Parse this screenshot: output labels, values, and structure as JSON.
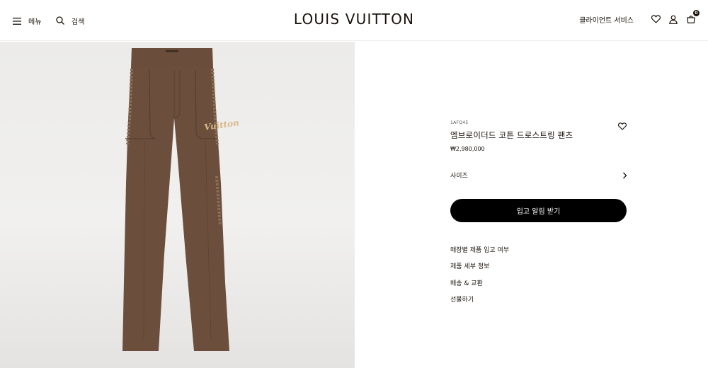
{
  "header": {
    "menu_label": "메뉴",
    "search_label": "검색",
    "logo": "LOUIS VUITTON",
    "client_service": "클라이언트 서비스",
    "bag_count": "0"
  },
  "product": {
    "sku": "1AFQ45",
    "name": "엠브로이더드 코튼 드로스트링 팬츠",
    "price": "₩2,980,000",
    "image_embroidery": "Vuitton"
  },
  "options": {
    "size_label": "사이즈"
  },
  "cta": {
    "label": "입고 알림 받기"
  },
  "links": [
    {
      "label": "매장별 제품 입고 여부"
    },
    {
      "label": "제품 세부 정보"
    },
    {
      "label": "배송 & 교환"
    },
    {
      "label": "선물하기"
    }
  ],
  "icons": {
    "menu": "hamburger-icon",
    "search": "search-icon",
    "wishlist": "heart-icon",
    "account": "person-icon",
    "bag": "shopping-bag-icon",
    "size_arrow": "chevron-right-icon"
  },
  "colors": {
    "text": "#19110b",
    "cta_background": "#000000",
    "pants": "#6b4f3c"
  }
}
